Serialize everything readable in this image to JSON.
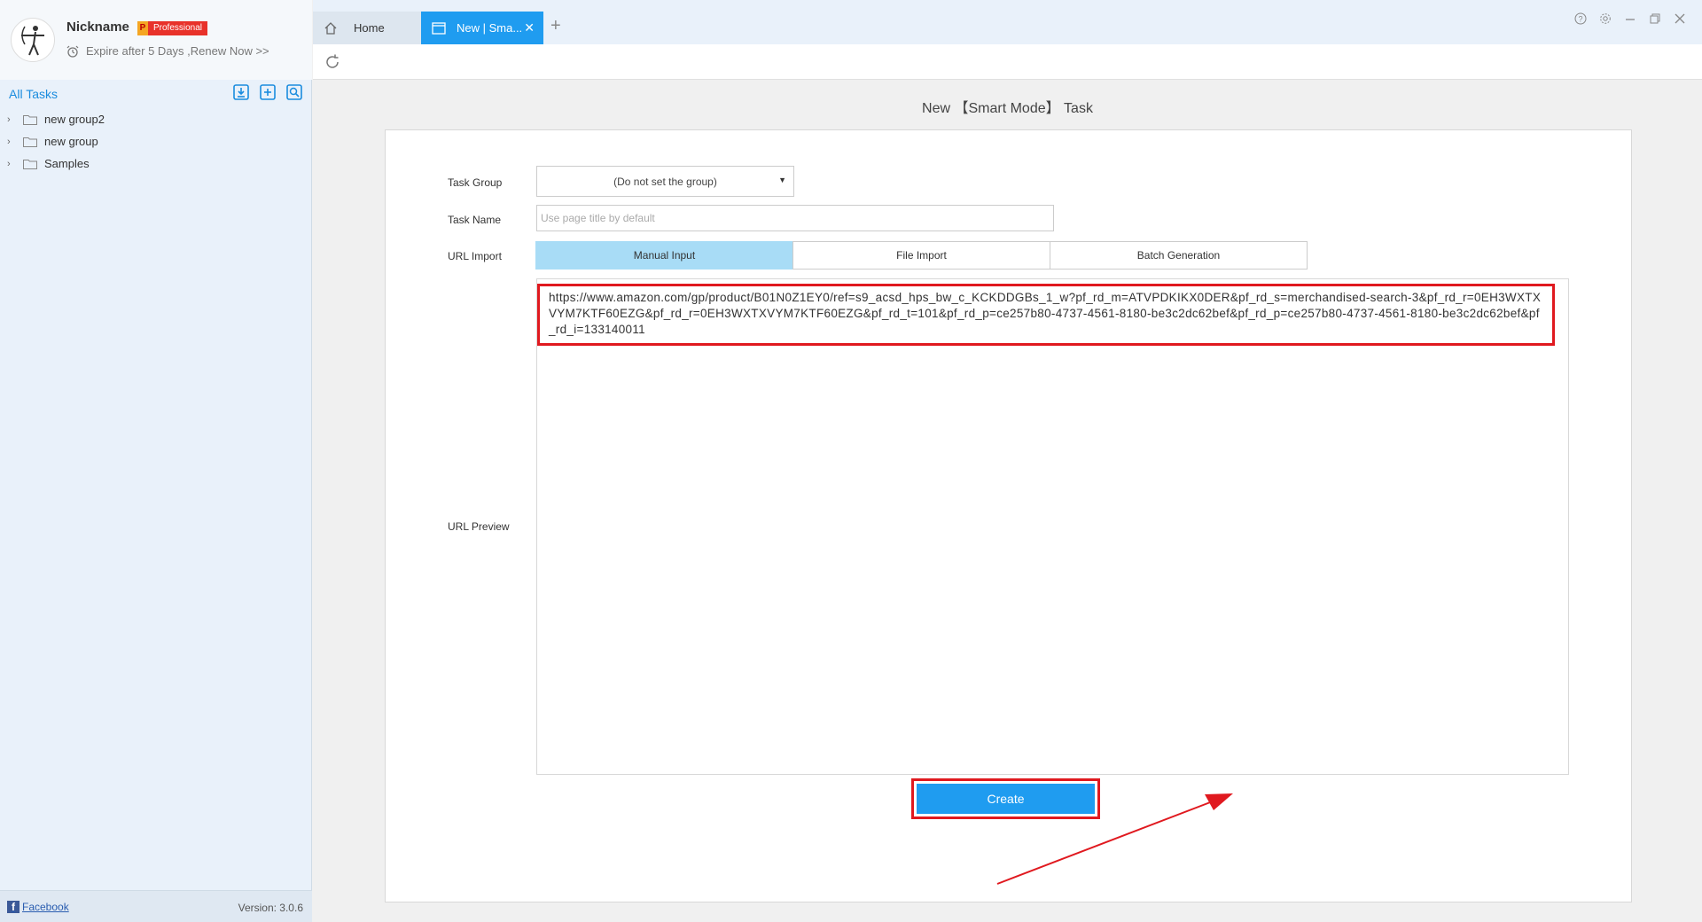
{
  "sidebar": {
    "nickname": "Nickname",
    "badge_letter": "P",
    "badge_label": "Professional",
    "expire_text": "Expire after 5 Days ,Renew Now >>",
    "all_tasks_label": "All Tasks",
    "tree": [
      {
        "label": "new group2"
      },
      {
        "label": "new group"
      },
      {
        "label": "Samples"
      }
    ],
    "footer": {
      "facebook_label": "Facebook",
      "version": "Version: 3.0.6"
    }
  },
  "tabs": {
    "home": "Home",
    "new": "New | Sma..."
  },
  "page": {
    "title": "New 【Smart Mode】 Task"
  },
  "form": {
    "task_group_label": "Task Group",
    "task_group_value": "(Do not set the group)",
    "task_name_label": "Task Name",
    "task_name_placeholder": "Use page title by default",
    "url_import_label": "URL Import",
    "url_import_options": [
      "Manual Input",
      "File Import",
      "Batch Generation"
    ],
    "url_import_selected": "Manual Input",
    "url_preview_label": "URL Preview",
    "url_value": "https://www.amazon.com/gp/product/B01N0Z1EY0/ref=s9_acsd_hps_bw_c_KCKDDGBs_1_w?pf_rd_m=ATVPDKIKX0DER&pf_rd_s=merchandised-search-3&pf_rd_r=0EH3WXTXVYM7KTF60EZG&pf_rd_r=0EH3WXTXVYM7KTF60EZG&pf_rd_t=101&pf_rd_p=ce257b80-4737-4561-8180-be3c2dc62bef&pf_rd_p=ce257b80-4737-4561-8180-be3c2dc62bef&pf_rd_i=133140011",
    "create_label": "Create"
  },
  "colors": {
    "accent": "#1f9cf0",
    "highlight": "#e0191f",
    "segment_active": "#a8dcf6"
  }
}
